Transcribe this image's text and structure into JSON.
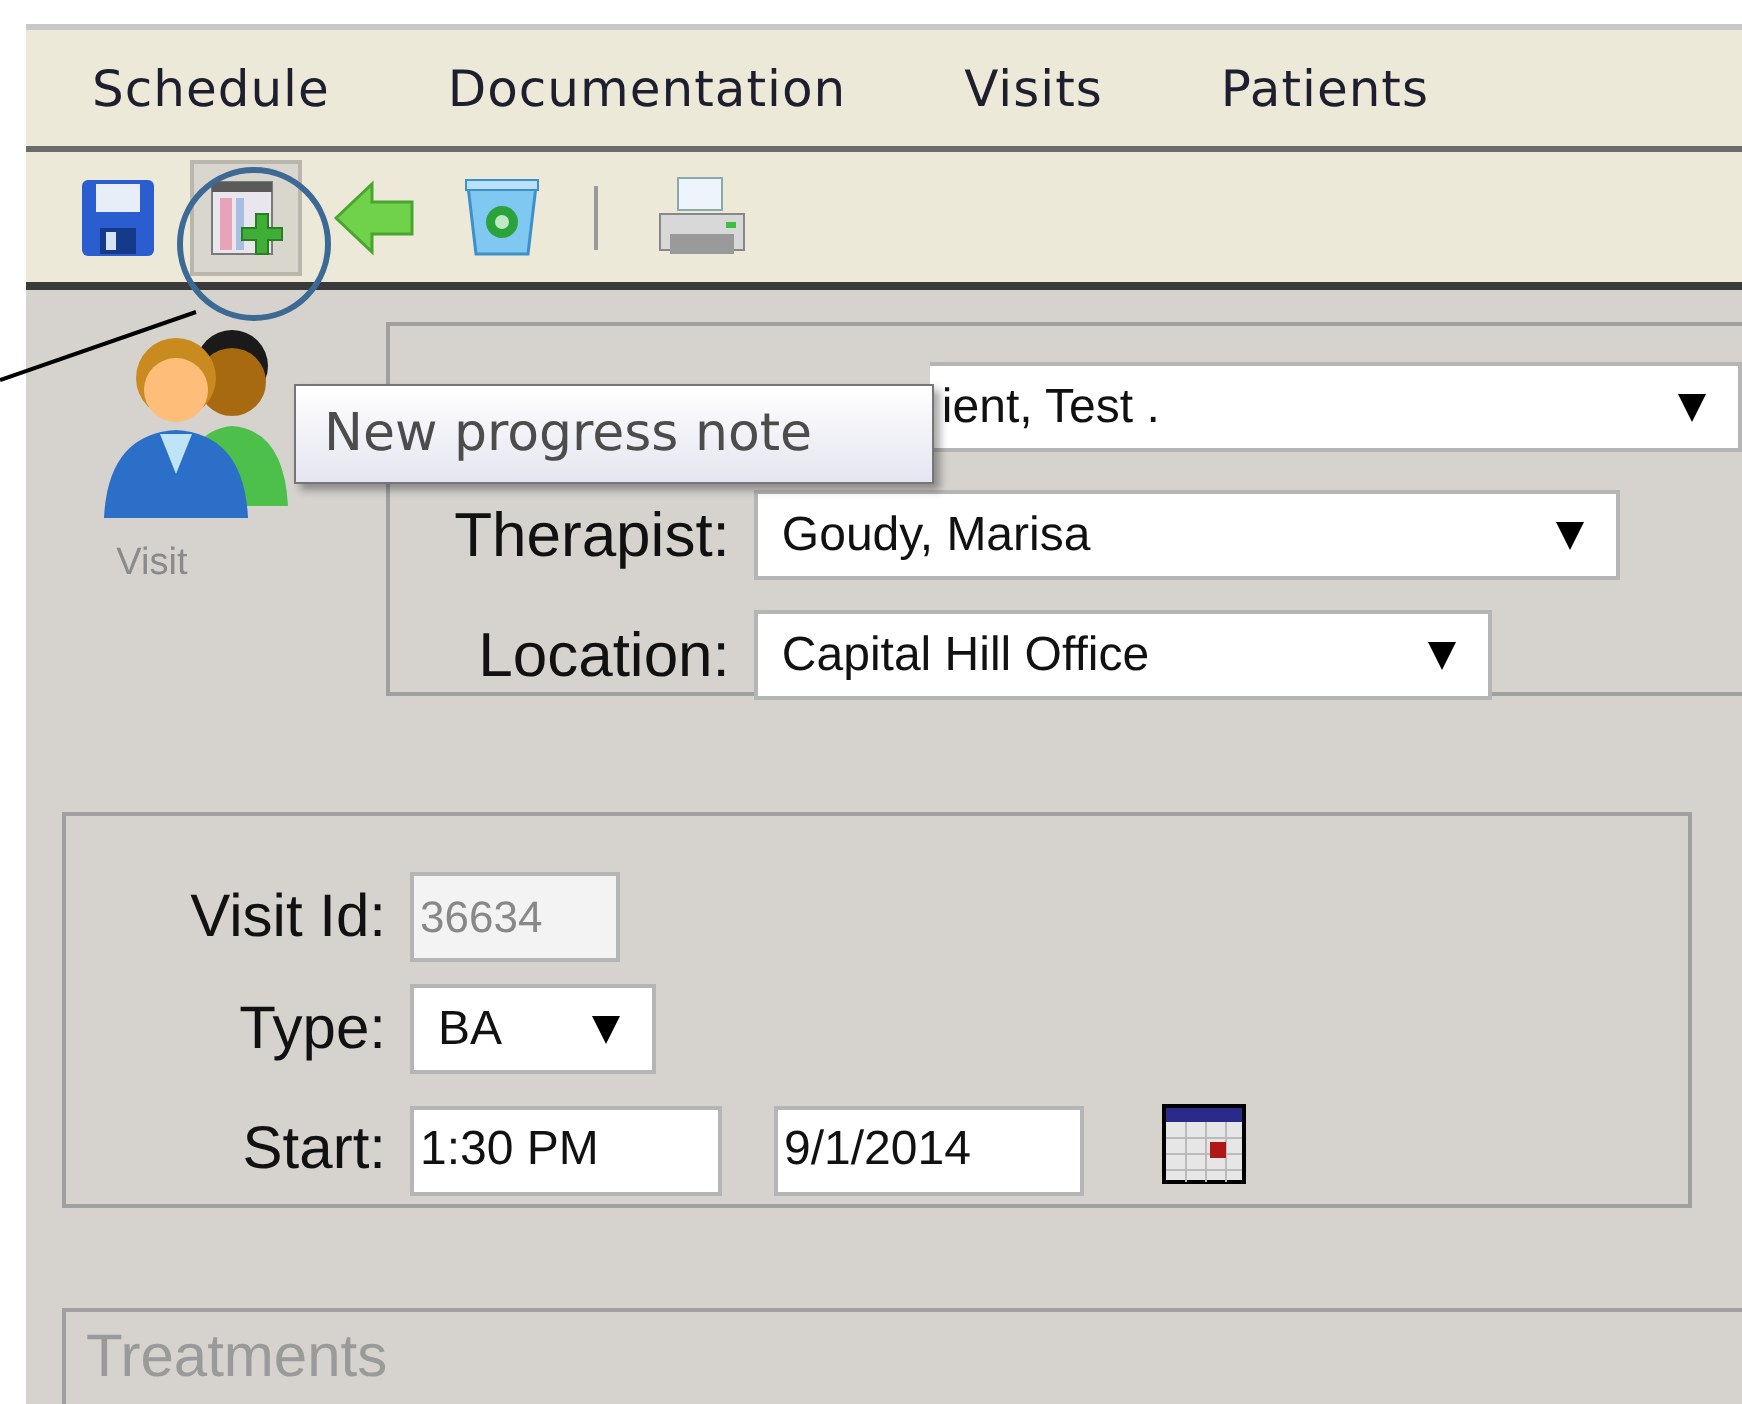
{
  "menu": [
    {
      "label": "Schedule"
    },
    {
      "label": "Documentation"
    },
    {
      "label": "Visits"
    },
    {
      "label": "Patients"
    }
  ],
  "toolbar": [
    {
      "kind": "save",
      "hovered": false
    },
    {
      "kind": "new-note",
      "hovered": true
    },
    {
      "kind": "back",
      "hovered": false
    },
    {
      "kind": "delete",
      "hovered": false
    },
    {
      "kind": "separator"
    },
    {
      "kind": "print",
      "hovered": false
    }
  ],
  "tooltip": "New progress note",
  "visit_icon_label": "Visit",
  "people_fields": [
    {
      "value": "ient, Test .",
      "kind": "combo"
    },
    {
      "label": "Therapist:",
      "value": "Goudy, Marisa",
      "kind": "combo"
    },
    {
      "label": "Location:",
      "value": "Capital Hill Office",
      "kind": "combo"
    }
  ],
  "visit_fields": [
    {
      "label": "Visit Id:",
      "kind": "readonly",
      "values": [
        "36634"
      ]
    },
    {
      "label": "Type:",
      "kind": "combo",
      "values": [
        "BA"
      ]
    },
    {
      "label": "Start:",
      "kind": "datetime",
      "values": [
        "1:30 PM",
        "9/1/2014"
      ]
    }
  ],
  "treatments": {
    "title": "Treatments"
  }
}
